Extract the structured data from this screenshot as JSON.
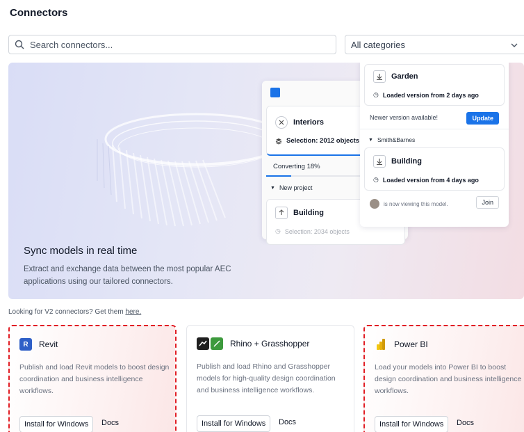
{
  "page": {
    "title": "Connectors"
  },
  "search": {
    "placeholder": "Search connectors..."
  },
  "category_select": {
    "value": "All categories"
  },
  "hero": {
    "title": "Sync models in real time",
    "description": "Extract and exchange data between the most popular AEC applications using our tailored connectors.",
    "left_panel": {
      "model_name": "Interiors",
      "selection": "Selection: 2012 objects",
      "status": "Converting 18%",
      "progress": 0.18,
      "project_label": "New project",
      "model2_name": "Building",
      "model2_selection": "Selection: 2034 objects"
    },
    "right_panel": {
      "model_name": "Garden",
      "loaded": "Loaded version from 2 days ago",
      "newer_notice": "Newer version available!",
      "update_label": "Update",
      "project_label": "Smith&Barnes",
      "model2_name": "Building",
      "model2_loaded": "Loaded version from 4 days ago",
      "viewer_text": "is now viewing this model.",
      "join_label": "Join"
    }
  },
  "v2_notice": {
    "text": "Looking for V2 connectors? Get them ",
    "link": "here."
  },
  "connectors": [
    {
      "name": "Revit",
      "description": "Publish and load Revit models to boost design coordination and business intelligence workflows.",
      "install_label": "Install for Windows",
      "docs_label": "Docs",
      "highlighted": true
    },
    {
      "name": "Rhino + Grasshopper",
      "description": "Publish and load Rhino and Grasshopper models for high-quality design coordination and business intelligence workflows.",
      "install_label": "Install for Windows",
      "docs_label": "Docs",
      "highlighted": false
    },
    {
      "name": "Power BI",
      "description": "Load your models into Power BI to boost design coordination and business intelligence workflows.",
      "install_label": "Install for Windows",
      "docs_label": "Docs",
      "highlighted": true
    }
  ],
  "colors": {
    "accent": "#1a73e8",
    "highlight_border": "#e11d24"
  },
  "icons": [
    "search-icon",
    "chevron-down-icon",
    "close-circle-icon",
    "layers-icon",
    "download-icon",
    "upload-icon",
    "clock-icon",
    "caret-down-icon",
    "revit-logo-icon",
    "rhino-logo-icon",
    "grasshopper-logo-icon",
    "powerbi-logo-icon"
  ]
}
